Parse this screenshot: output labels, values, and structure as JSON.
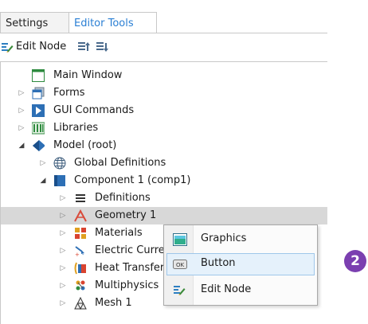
{
  "tabs": [
    {
      "label": "Settings",
      "active": false
    },
    {
      "label": "Editor Tools",
      "active": true
    }
  ],
  "toolbar": {
    "edit_node_label": "Edit Node",
    "icons": [
      "edit-node-icon",
      "move-up-icon",
      "move-down-icon"
    ]
  },
  "tree": {
    "rows": [
      {
        "label": "Main Window",
        "icon": "window-icon",
        "expander": "none"
      },
      {
        "label": "Forms",
        "icon": "forms-icon",
        "expander": "collapsed"
      },
      {
        "label": "GUI Commands",
        "icon": "gui-commands-icon",
        "expander": "collapsed"
      },
      {
        "label": "Libraries",
        "icon": "libraries-icon",
        "expander": "collapsed"
      },
      {
        "label": "Model (root)",
        "icon": "model-icon",
        "expander": "expanded"
      },
      {
        "label": "Global Definitions",
        "icon": "globe-icon",
        "expander": "collapsed"
      },
      {
        "label": "Component 1 (comp1)",
        "icon": "component-icon",
        "expander": "expanded"
      },
      {
        "label": "Definitions",
        "icon": "definitions-icon",
        "expander": "collapsed"
      },
      {
        "label": "Geometry 1",
        "icon": "geometry-icon",
        "expander": "collapsed",
        "selected": true
      },
      {
        "label": "Materials",
        "icon": "materials-icon",
        "expander": "collapsed"
      },
      {
        "label": "Electric Curre",
        "icon": "electric-currents-icon",
        "expander": "collapsed"
      },
      {
        "label": "Heat Transfer",
        "icon": "heat-transfer-icon",
        "expander": "collapsed"
      },
      {
        "label": "Multiphysics",
        "icon": "multiphysics-icon",
        "expander": "collapsed"
      },
      {
        "label": "Mesh 1",
        "icon": "mesh-icon",
        "expander": "collapsed"
      }
    ]
  },
  "context_menu": {
    "items": [
      {
        "label": "Graphics",
        "icon": "graphics-icon",
        "highlighted": false
      },
      {
        "label": "Button",
        "icon": "button-icon",
        "highlighted": true
      },
      {
        "label": "Edit Node",
        "icon": "edit-node-icon",
        "highlighted": false
      }
    ]
  },
  "callout": {
    "number": "2",
    "color": "#7b3fb0"
  },
  "colors": {
    "accent": "#2a7fd4",
    "selection": "#d8d8d8",
    "menu_hover": "#e5f1fb"
  }
}
